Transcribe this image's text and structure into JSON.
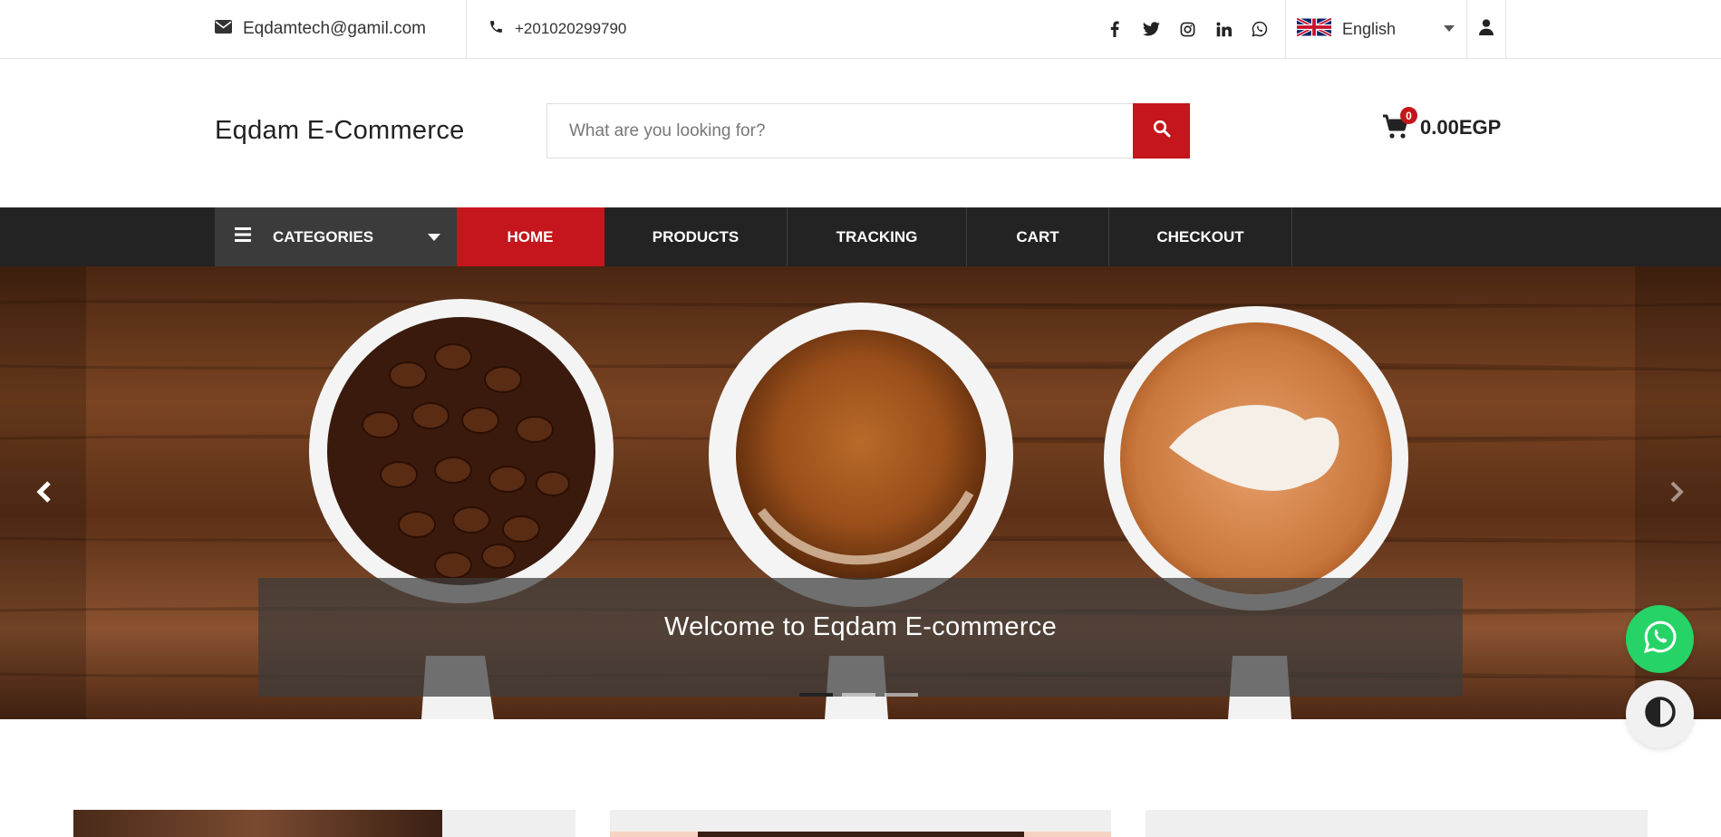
{
  "topbar": {
    "email": "Eqdamtech@gamil.com",
    "phone": "+201020299790",
    "social_icons": [
      "facebook-icon",
      "twitter-icon",
      "instagram-icon",
      "linkedin-icon",
      "whatsapp-icon"
    ],
    "language": "English",
    "language_flag": "uk-flag-icon"
  },
  "header": {
    "brand": "Eqdam E-Commerce",
    "search_placeholder": "What are you looking for?",
    "cart_count": "0",
    "cart_total": "0.00EGP"
  },
  "nav": {
    "categories_label": "CATEGORIES",
    "items": [
      "HOME",
      "PRODUCTS",
      "TRACKING",
      "CART",
      "CHECKOUT"
    ],
    "active_item": "HOME"
  },
  "hero": {
    "caption": "Welcome to Eqdam E-commerce",
    "slide_count": 3,
    "active_slide": 1
  },
  "colors": {
    "accent": "#c4161c",
    "nav_bg": "#232323",
    "whatsapp": "#25d366"
  }
}
